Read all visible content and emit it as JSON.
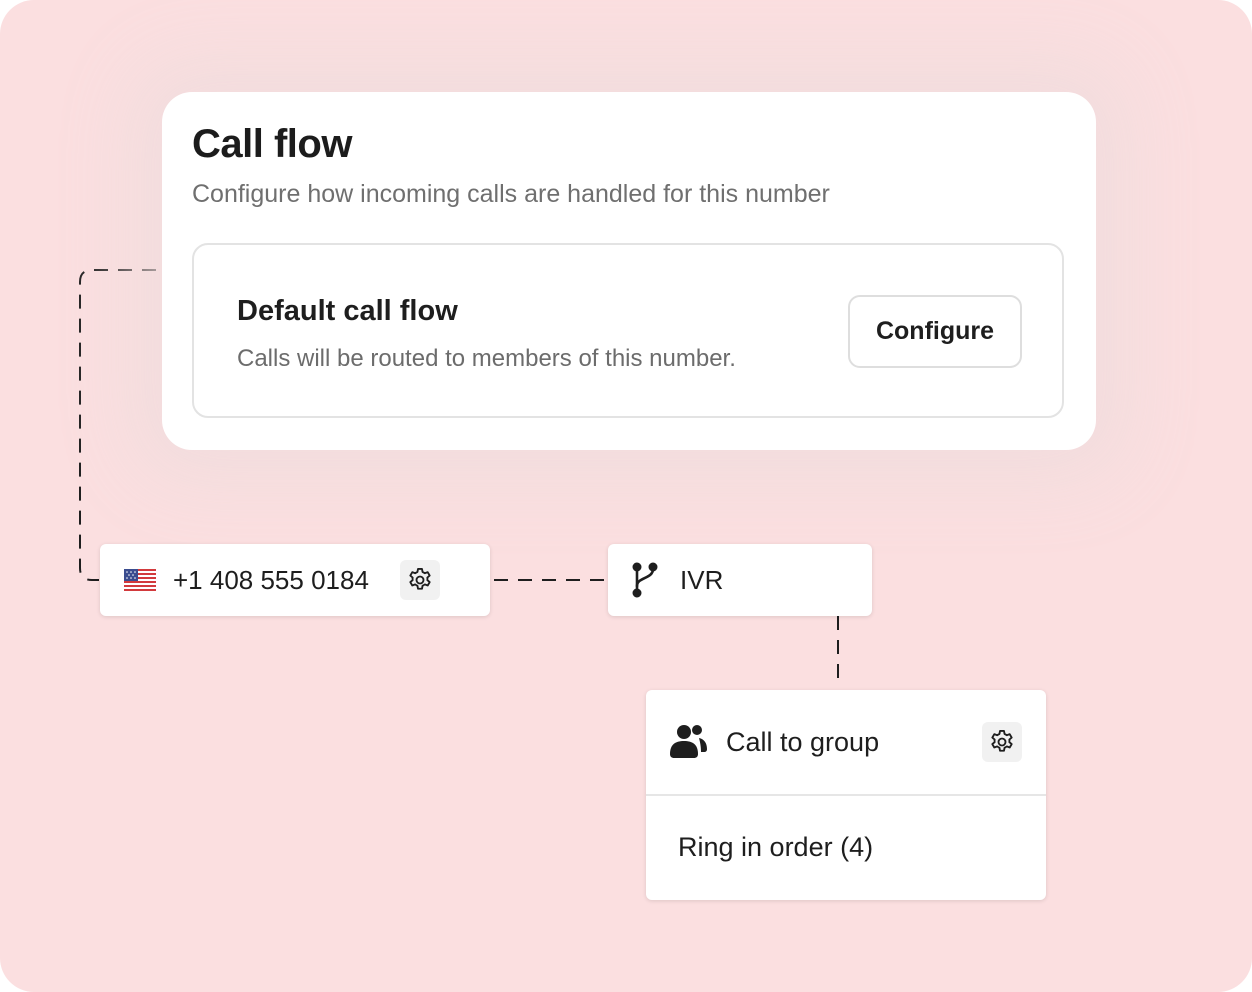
{
  "call_flow": {
    "title": "Call flow",
    "subtitle": "Configure how incoming calls are handled for this number",
    "default_flow": {
      "title": "Default call flow",
      "description": "Calls will be routed to members of this number.",
      "configure_label": "Configure"
    }
  },
  "flow": {
    "phone_node": {
      "flag_icon": "us-flag-icon",
      "number": "+1 408 555 0184",
      "settings_icon": "gear-icon"
    },
    "ivr_node": {
      "icon": "branch-icon",
      "label": "IVR"
    },
    "group_node": {
      "icon": "users-icon",
      "label": "Call to group",
      "settings_icon": "gear-icon",
      "strategy": "Ring in order (4)"
    }
  },
  "colors": {
    "background": "#fbdfe0",
    "card": "#ffffff",
    "text": "#1e1e1e",
    "muted_text": "#6f6f6f"
  }
}
